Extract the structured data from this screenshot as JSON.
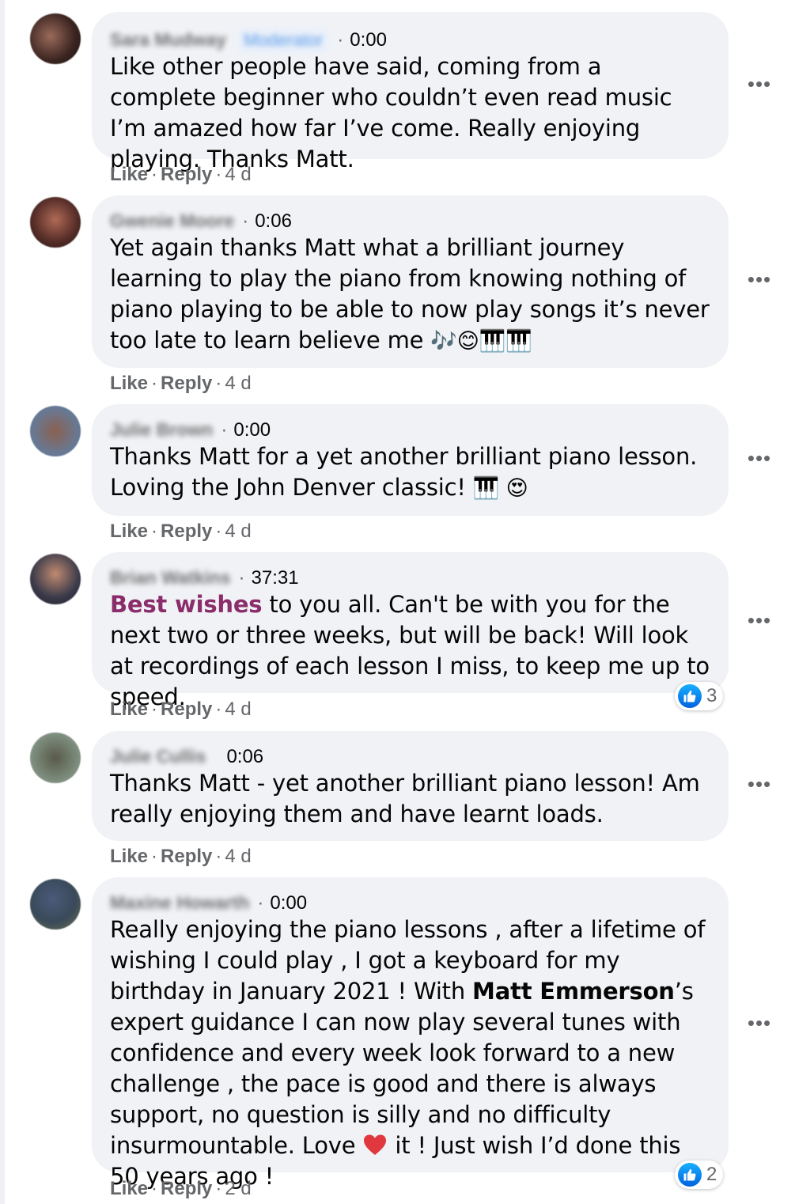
{
  "comments": [
    {
      "author": "Sara Mudway",
      "badge": "Moderator",
      "timestamp": "0:00",
      "text": "Like other people have said, coming from a complete beginner who couldn’t even read music I’m amazed how far I’ve come. Really enjoying playing. Thanks Matt.",
      "like_label": "Like",
      "reply_label": "Reply",
      "age": "4 d"
    },
    {
      "author": "Gwenie Moore",
      "timestamp": "0:06",
      "text": "Yet again thanks Matt what a brilliant journey learning to play the piano from knowing nothing of piano playing to be able to now play songs it’s never too late to learn believe me",
      "emoji": "🎶😊🎹🎹",
      "like_label": "Like",
      "reply_label": "Reply",
      "age": "4 d"
    },
    {
      "author": "Julie Brown",
      "timestamp": "0:00",
      "text": "Thanks Matt for a yet another brilliant piano lesson. Loving the John Denver classic!",
      "emoji": "🎹 😍",
      "like_label": "Like",
      "reply_label": "Reply",
      "age": "4 d"
    },
    {
      "author": "Brian Watkins",
      "timestamp": "37:31",
      "tag": "Best wishes",
      "text": " to you all. Can't be with you for the next two or three weeks, but will be back! Will look at recordings of each lesson I miss, to keep me up to speed.",
      "like_label": "Like",
      "reply_label": "Reply",
      "age": "4 d",
      "reaction_count": "3"
    },
    {
      "author": "Julie Cullis",
      "timestamp": "0:06",
      "text": "Thanks Matt - yet another brilliant piano lesson! Am really enjoying them and have learnt loads.",
      "like_label": "Like",
      "reply_label": "Reply",
      "age": "4 d"
    },
    {
      "author": "Maxine Howarth",
      "timestamp": "0:00",
      "text_before": "Really enjoying the piano lessons , after a lifetime of wishing I could play , I got a keyboard for my birthday in January 2021 ! With ",
      "mention": "Matt Emmerson",
      "text_middle": "’s expert guidance I can now play several tunes with confidence and every week look forward to a new challenge , the pace is good and there is always support, no question is silly and no difficulty insurmountable. Love ",
      "text_after": " it ! Just wish I’d done this 50 years ago !",
      "like_label": "Like",
      "reply_label": "Reply",
      "age": "2 d",
      "reaction_count": "2"
    }
  ],
  "icons": {
    "more": "more-options-icon",
    "like_reaction": "like-reaction-icon",
    "heart": "heart-emoji-icon"
  },
  "colors": {
    "bubble": "#f0f2f5",
    "tag": "#8b2c6b",
    "like_blue": "#1877f2",
    "secondary_text": "#65676b"
  }
}
